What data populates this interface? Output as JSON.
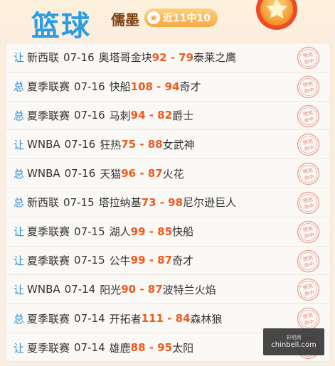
{
  "header": {
    "title": "篮球",
    "expert": "儒墨",
    "record": "近11中10",
    "accent_color": "#2a9de6",
    "score_color": "#ef5a1c"
  },
  "stamp_text": "预测命中",
  "rows": [
    {
      "type": "让",
      "league": "新西联",
      "date": "07-16",
      "home": "奥塔哥金块",
      "score": "92 - 79",
      "away": "泰莱之鹰"
    },
    {
      "type": "总",
      "league": "夏季联赛",
      "date": "07-16",
      "home": "快船",
      "score": "108 - 94",
      "away": "奇才"
    },
    {
      "type": "总",
      "league": "夏季联赛",
      "date": "07-16",
      "home": "马刺",
      "score": "94 - 82",
      "away": "爵士"
    },
    {
      "type": "让",
      "league": "WNBA",
      "date": "07-16",
      "home": "狂热",
      "score": "75 - 88",
      "away": "女武神"
    },
    {
      "type": "总",
      "league": "WNBA",
      "date": "07-16",
      "home": "天猫",
      "score": "96 - 87",
      "away": "火花"
    },
    {
      "type": "总",
      "league": "新西联",
      "date": "07-15",
      "home": "塔拉纳基",
      "score": "73 - 98",
      "away": "尼尔逊巨人"
    },
    {
      "type": "让",
      "league": "夏季联赛",
      "date": "07-15",
      "home": "湖人",
      "score": "99 - 85",
      "away": "快船"
    },
    {
      "type": "让",
      "league": "夏季联赛",
      "date": "07-15",
      "home": "公牛",
      "score": "99 - 87",
      "away": "奇才"
    },
    {
      "type": "让",
      "league": "WNBA",
      "date": "07-14",
      "home": "阳光",
      "score": "90 - 87",
      "away": "波特兰火焰"
    },
    {
      "type": "总",
      "league": "夏季联赛",
      "date": "07-14",
      "home": "开拓者",
      "score": "111 - 84",
      "away": "森林狼"
    },
    {
      "type": "让",
      "league": "夏季联赛",
      "date": "07-14",
      "home": "雄鹿",
      "score": "88 - 95",
      "away": "太阳"
    }
  ],
  "watermark": {
    "line1": "彩吧网",
    "url": "chinbell.com"
  }
}
